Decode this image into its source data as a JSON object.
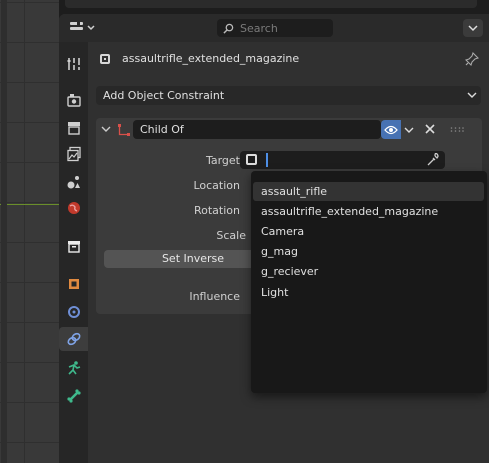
{
  "header": {
    "search_placeholder": "Search"
  },
  "object": {
    "name": "assaultrifle_extended_magazine"
  },
  "add_constraint": {
    "label": "Add Object Constraint"
  },
  "constraint": {
    "name": "Child Of",
    "target_label": "Target",
    "location_label": "Location",
    "rotation_label": "Rotation",
    "scale_label": "Scale",
    "set_inverse_label": "Set Inverse",
    "influence_label": "Influence"
  },
  "dropdown": {
    "items": [
      "assault_rifle",
      "assaultrifle_extended_magazine",
      "Camera",
      "g_mag",
      "g_reciever",
      "Light"
    ]
  },
  "tabs": [
    "tool-icon",
    "render-icon",
    "output-icon",
    "view-layer-icon",
    "scene-icon",
    "world-icon",
    "collection-icon",
    "object-icon",
    "modifiers-icon",
    "constraints-icon",
    "physics-icon",
    "data-icon"
  ],
  "colors": {
    "accent": "#4772b3",
    "highlight": "#333333"
  }
}
